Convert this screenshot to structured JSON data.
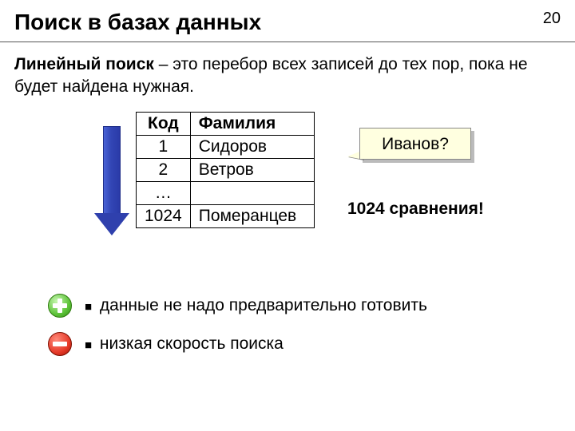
{
  "page_number": "20",
  "title": "Поиск в базах данных",
  "definition": {
    "term": "Линейный поиск",
    "rest": " – это перебор всех записей до тех пор, пока не будет найдена нужная."
  },
  "table": {
    "headers": {
      "code": "Код",
      "name": "Фамилия"
    },
    "rows": [
      {
        "code": "1",
        "name": "Сидоров"
      },
      {
        "code": "2",
        "name": "Ветров"
      },
      {
        "code": "…",
        "name": ""
      },
      {
        "code": "1024",
        "name": "Померанцев"
      }
    ]
  },
  "callout": "Иванов?",
  "comparisons": "1024 сравнения!",
  "bullets": {
    "plus": "данные не надо предварительно готовить",
    "minus": "низкая скорость поиска"
  },
  "chart_data": {
    "type": "table",
    "columns": [
      "Код",
      "Фамилия"
    ],
    "rows": [
      [
        "1",
        "Сидоров"
      ],
      [
        "2",
        "Ветров"
      ],
      [
        "…",
        ""
      ],
      [
        "1024",
        "Померанцев"
      ]
    ]
  }
}
